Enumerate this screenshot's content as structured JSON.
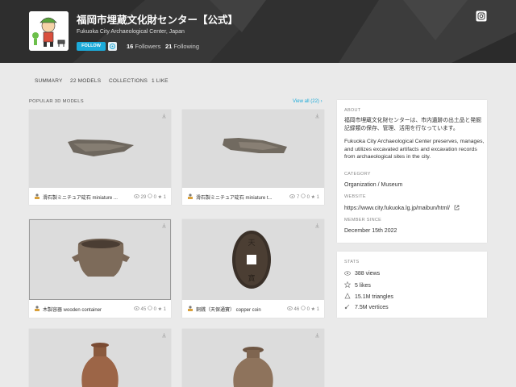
{
  "profile": {
    "title": "福岡市埋蔵文化財センター【公式】",
    "subtitle": "Fukuoka City Archaeological Center, Japan",
    "follow_label": "FOLLOW",
    "followers_count": "16",
    "followers_label": "Followers",
    "following_count": "21",
    "following_label": "Following"
  },
  "tabs": [
    {
      "label": "SUMMARY"
    },
    {
      "label": "22 MODELS"
    },
    {
      "label": "COLLECTIONS"
    },
    {
      "label": "1 LIKE"
    }
  ],
  "models_section": {
    "title": "POPULAR 3D MODELS",
    "view_all": "View all (22)"
  },
  "models": [
    {
      "name": "滑石製ミニチュア碇石 miniature ...",
      "views": "29",
      "comments": "0",
      "likes": "1"
    },
    {
      "name": "滑石製ミニチュア碇石 miniature t...",
      "views": "7",
      "comments": "0",
      "likes": "1"
    },
    {
      "name": "木製容器 wooden container",
      "views": "45",
      "comments": "0",
      "likes": "1"
    },
    {
      "name": "銅銭（天保通寶） copper coin",
      "views": "46",
      "comments": "0",
      "likes": "1"
    }
  ],
  "about": {
    "label": "ABOUT",
    "text_ja": "福岡市埋蔵文化財センターは、市内遺跡の出土品と発掘記録類の保存、管理、活用を行なっています。",
    "text_en": "Fukuoka City Archaeological Center preserves, manages, and utilizes excavated artifacts and excavation records from archaeological sites in the city.",
    "category_label": "CATEGORY",
    "category": "Organization / Museum",
    "website_label": "WEBSITE",
    "website": "https://www.city.fukuoka.lg.jp/maibun/html/",
    "member_since_label": "MEMBER SINCE",
    "member_since": "December 15th 2022"
  },
  "stats": {
    "label": "STATS",
    "views": "388 views",
    "likes": "5 likes",
    "triangles": "15.1M triangles",
    "vertices": "7.5M vertices"
  },
  "colors": {
    "accent": "#1caad9",
    "header_bg": "#333333",
    "page_bg": "#eaeaea"
  }
}
